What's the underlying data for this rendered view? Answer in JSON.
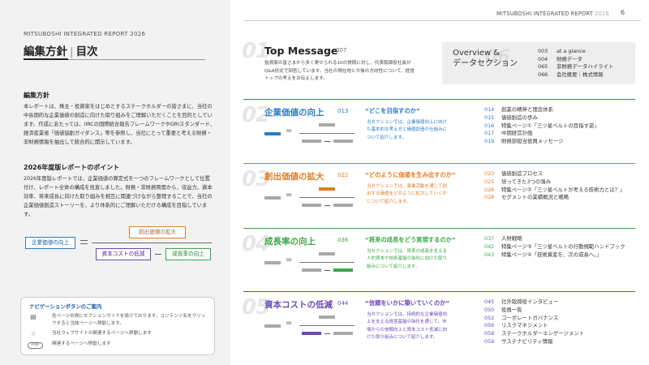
{
  "left": {
    "brand": "MITSUBOSHI INTEGRATED REPORT 2026",
    "title_a": "編集方針",
    "title_sep": "|",
    "title_b": "目次",
    "policy_heading": "編集方針",
    "policy_text": "本レポートは、株主・投資家をはじめとするステークホルダーの皆さまに、当社の中長期的な企業価値の創造に向けた取り組みをご理解いただくことを目的としています。作成にあたっては、IIRCの国際統合報告フレームワークやGRIスタンダード、経済産業省「価値協創ガイダンス」等を参照し、当社にとって重要と考える財務・非財務情報を抽出して統合的に開示しています。",
    "points_heading": "2026年度版レポートのポイント",
    "points_text": "2026年度版レポートでは、企業価値の算定式を一つのフレームワークとして位置付け、レポート全体の構成を見直しました。財務・非財務両面から、収益力、資本効率、将来成長に向けた取り組みを相互に関連づけながら整理することで、当社の企業価値創造ストーリーを、より体系的にご理解いただける構成を目指しています。",
    "equation": {
      "left": "企業価値の向上",
      "top": "創出価値の拡大",
      "bottom_left": "資本コストの低減",
      "bottom_right": "成長率の向上"
    },
    "nav": {
      "title": "ナビゲーションボタンのご案内",
      "row1": "各ページ右側にセクションガイドを設けております。コンテンツ名をクリックすると当該ページへ移動します。",
      "row2": "当社ウェブサイトの関連するページへ移動します",
      "row3": "関連するページへ移動します",
      "pill": "P.00"
    }
  },
  "right": {
    "brand": "MITSUBOSHI INTEGRATED REPORT",
    "brand_year": "2026",
    "page_number": "6",
    "top_message": {
      "num": "01",
      "title": "Top Message",
      "page": "007",
      "desc": "投資家の皆さまから多く寄せられる10の質問に対し、代表取締役社長がQ&A形式で回答しています。当社の現在地と今後の方向性について、経営トップの考えをお伝えします。"
    },
    "overview": {
      "title_line1": "Overview &",
      "title_line2": "データセクション",
      "num": "06",
      "items": [
        {
          "n": "003",
          "t": "at a glance"
        },
        {
          "n": "004",
          "t": "財務データ"
        },
        {
          "n": "065",
          "t": "非財務データハイライト"
        },
        {
          "n": "066",
          "t": "会社概要｜株式情報"
        }
      ]
    },
    "sections": [
      {
        "num": "02",
        "title": "企業価値の向上",
        "page": "013",
        "question": "“どこを目指すのか”",
        "desc": "当セクションでは、企業価値向上に向けた基本的な考え方と価値創造の仕組みについて紹介します。",
        "color": "#2b7cc4",
        "list": [
          {
            "n": "014",
            "t": "創業の精神と理念体系"
          },
          {
            "n": "015",
            "t": "価値創造の歩み"
          },
          {
            "n": "016",
            "t": "特集ページ①「三ツ星ベルトの目指す姿」"
          },
          {
            "n": "017",
            "t": "中期経営計画"
          },
          {
            "n": "019",
            "t": "財務部担当役員メッセージ"
          }
        ]
      },
      {
        "num": "03",
        "title": "創出価値の拡大",
        "page": "022",
        "question": "“どのように価値を生み出すのか”",
        "desc": "当セクションでは、事業活動を通じて創出する価値をどのように拡大していくかについて紹介します。",
        "color": "#e07d26",
        "list": [
          {
            "n": "023",
            "t": "価値創造プロセス"
          },
          {
            "n": "025",
            "t": "培ってきた3つの強み"
          },
          {
            "n": "026",
            "t": "特集ページ②「三ツ星ベルトが考える技術力とは？」"
          },
          {
            "n": "028",
            "t": "セグメントの業績概況と戦略"
          }
        ]
      },
      {
        "num": "04",
        "title": "成長率の向上",
        "page": "036",
        "question": "“将来の成長をどう実現するのか”",
        "desc": "当セクションでは、将来の成長を支える人的資本や技術基盤の強化に向けた取り組みについて紹介します。",
        "color": "#3aa64c",
        "list": [
          {
            "n": "037",
            "t": "人財戦略"
          },
          {
            "n": "042",
            "t": "特集ページ③「三ツ星ベルトの行動規範ハンドブック"
          },
          {
            "n": "043",
            "t": "特集ページ④「技術資産を、次の成長へ。」"
          }
        ]
      },
      {
        "num": "05",
        "title": "資本コストの低減",
        "page": "044",
        "question": "“信頼をいかに築いていくのか”",
        "desc": "当セクションでは、持続的な企業価値向上を支える経営基盤の強化を通じて、市場からの信頼向上と資本コスト低減に向けた取り組みについて紹介します。",
        "color": "#6a4bb4",
        "list": [
          {
            "n": "045",
            "t": "社外取締役インタビュー"
          },
          {
            "n": "050",
            "t": "役員一覧"
          },
          {
            "n": "052",
            "t": "コーポレートガバナンス"
          },
          {
            "n": "056",
            "t": "リスクマネジメント"
          },
          {
            "n": "058",
            "t": "ステークホルダーエンゲージメント"
          },
          {
            "n": "059",
            "t": "サステナビリティ情報"
          }
        ]
      }
    ]
  }
}
